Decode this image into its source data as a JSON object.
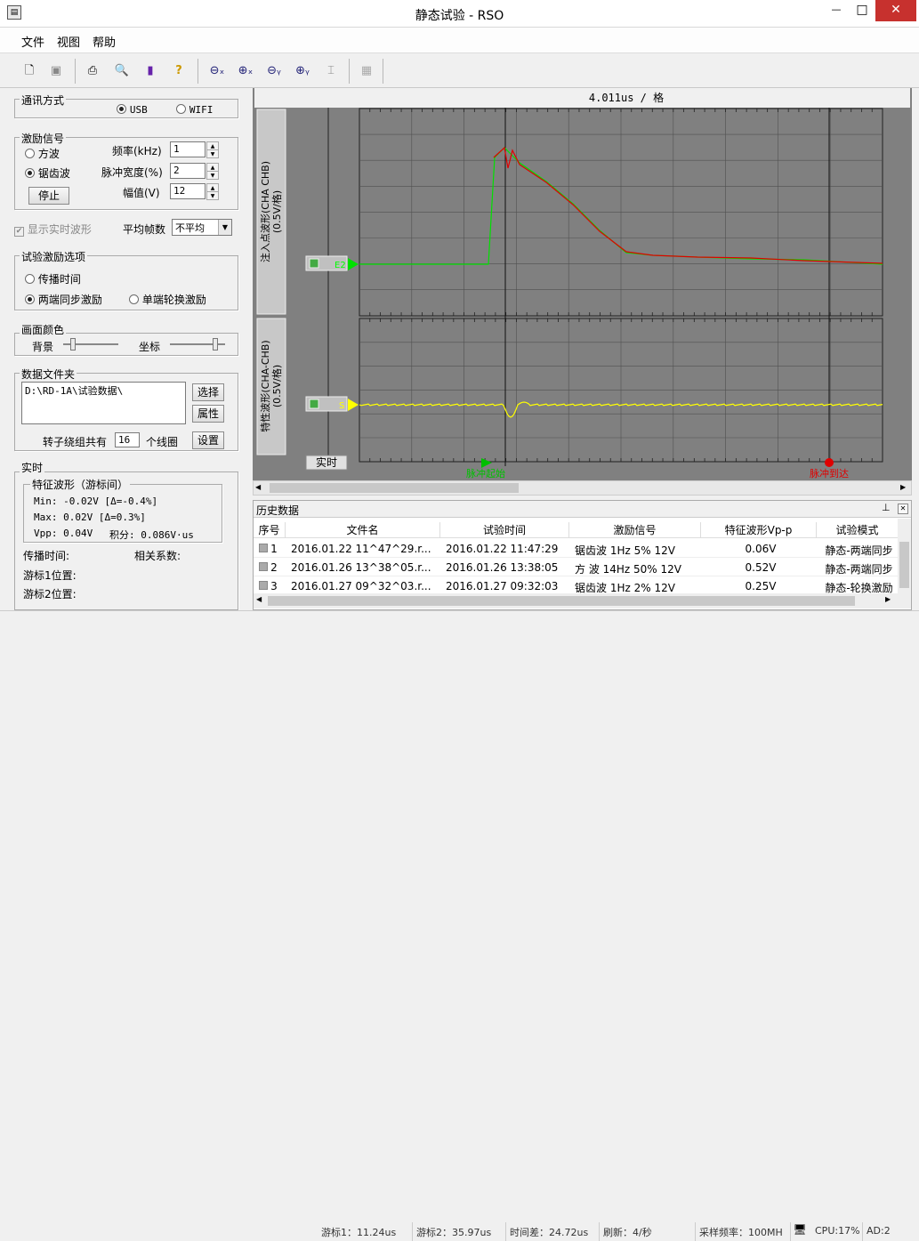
{
  "window": {
    "title": "静态试验 - RSO",
    "minimize": "—",
    "maximize": "□",
    "close": "✕"
  },
  "menu": [
    "文件",
    "视图",
    "帮助"
  ],
  "toolbar": {
    "icons": [
      "new-icon",
      "save-icon",
      "print-icon",
      "preview-icon",
      "book-icon",
      "help-icon",
      "zoom-out-x-icon",
      "zoom-in-x-icon",
      "zoom-out-y-icon",
      "zoom-in-y-icon",
      "cursor-icon",
      "table-icon"
    ]
  },
  "comm": {
    "label": "通讯方式",
    "usb": "USB",
    "wifi": "WIFI",
    "selected": "USB"
  },
  "excite": {
    "label": "激励信号",
    "square": "方波",
    "sawtooth": "锯齿波",
    "selected": "锯齿波",
    "stop": "停止",
    "freq_label": "频率(kHz)",
    "freq": "1",
    "width_label": "脉冲宽度(%)",
    "width": "2",
    "amp_label": "幅值(V)",
    "amp": "12"
  },
  "realtime": {
    "label": "显示实时波形",
    "checked": true,
    "avg_label": "平均帧数",
    "avg_value": "不平均"
  },
  "options": {
    "label": "试验激励选项",
    "propagation": "传播时间",
    "both": "两端同步激励",
    "single": "单端轮换激励",
    "selected": "两端同步激励"
  },
  "colors": {
    "label": "画面颜色",
    "bg": "背景",
    "axis": "坐标",
    "bg_level": 0.15,
    "axis_level": 0.85
  },
  "datafolder": {
    "label": "数据文件夹",
    "path": "D:\\RD-1A\\试验数据\\",
    "select": "选择",
    "props": "属性",
    "coils_prefix": "转子绕组共有",
    "coils": "16",
    "coils_suffix": "个线圈",
    "settings": "设置"
  },
  "live": {
    "label": "实时",
    "sub": "特征波形（游标间）",
    "min": "Min: -0.02V [Δ=-0.4%]",
    "max": "Max: 0.02V [Δ=0.3%]",
    "vpp": "Vpp: 0.04V",
    "integral": "积分: 0.086V·us",
    "prop_time": "传播时间:",
    "correlation": "相关系数:",
    "cursor1": "游标1位置:",
    "cursor2": "游标2位置:"
  },
  "scope": {
    "timebase": "4.011us / 格",
    "ch1_label": "注入点波形(CHA CHB)",
    "ch1_scale": "(0.5V/格)",
    "ch2_label": "特性波形(CHA-CHB)",
    "ch2_scale": "(0.5V/格)",
    "ch1_tag": "E2",
    "ch2_tag": "S",
    "realtime_btn": "实时",
    "marker1": "脉冲起始",
    "marker2": "脉冲到达",
    "colors": {
      "green": "#00e000",
      "red": "#e00000",
      "yellow": "#ffff00",
      "grid": "#505050"
    }
  },
  "history": {
    "title": "历史数据",
    "pin": "ᵖ",
    "close": "✕",
    "columns": [
      "序号",
      "文件名",
      "试验时间",
      "激励信号",
      "特征波形Vp-p",
      "试验模式"
    ],
    "rows": [
      [
        "1",
        "2016.01.22 11^47^29.r...",
        "2016.01.22 11:47:29",
        "锯齿波  1Hz   5%  12V",
        "0.06V",
        "静态-两端同步"
      ],
      [
        "2",
        "2016.01.26 13^38^05.r...",
        "2016.01.26 13:38:05",
        "方 波 14Hz  50%  12V",
        "0.52V",
        "静态-两端同步"
      ],
      [
        "3",
        "2016.01.27 09^32^03.r...",
        "2016.01.27 09:32:03",
        "锯齿波  1Hz   2%  12V",
        "0.25V",
        "静态-轮换激励"
      ]
    ]
  },
  "status": [
    "游标1：11.24us",
    "游标2：35.97us",
    "时间差：24.72us",
    "刷新：4/秒",
    "采样频率：100MH",
    "CPU:17%",
    "AD:2"
  ]
}
